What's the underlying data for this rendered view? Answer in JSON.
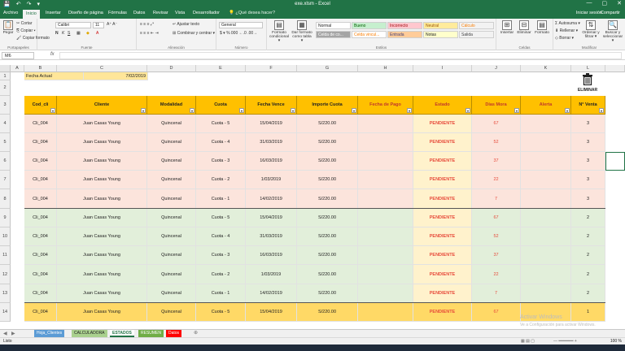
{
  "window": {
    "title": "exe.xlsm - Excel",
    "quick_access": [
      "💾",
      "↶",
      "↷",
      "▾"
    ],
    "min": "—",
    "max": "▢",
    "close": "✕"
  },
  "tabs": [
    "Archivo",
    "Inicio",
    "Insertar",
    "Diseño de página",
    "Fórmulas",
    "Datos",
    "Revisar",
    "Vista",
    "Desarrollador"
  ],
  "tell_me": "¿Qué desea hacer?",
  "signin": "Iniciar sesión",
  "share": "Compartir",
  "ribbon": {
    "paste": "Pegar",
    "cut": "Cortar",
    "copy": "Copiar ▾",
    "format_painter": "Copiar formato",
    "clipboard_label": "Portapapeles",
    "font_name": "Calibri",
    "font_size": "11",
    "font_label": "Fuente",
    "wrap": "Ajustar texto",
    "merge": "Combinar y centrar ▾",
    "align_label": "Alineación",
    "number_format": "General",
    "number_label": "Número",
    "cond_format": "Formato condicional ▾",
    "as_table": "Dar formato como tabla ▾",
    "styles": [
      {
        "text": "Normal",
        "bg": "#ffffff",
        "fg": "#222222"
      },
      {
        "text": "Bueno",
        "bg": "#c6efce",
        "fg": "#006100"
      },
      {
        "text": "Incorrecto",
        "bg": "#ffc7ce",
        "fg": "#9c0006"
      },
      {
        "text": "Neutral",
        "bg": "#ffeb9c",
        "fg": "#9c5700"
      },
      {
        "text": "Cálculo",
        "bg": "#f2f2f2",
        "fg": "#fa7d00"
      },
      {
        "text": "Celda de co...",
        "bg": "#a5a5a5",
        "fg": "#ffffff"
      },
      {
        "text": "Celda vincul...",
        "bg": "#ffffff",
        "fg": "#fa7d00"
      },
      {
        "text": "Entrada",
        "bg": "#ffcc99",
        "fg": "#3f3f76"
      },
      {
        "text": "Notas",
        "bg": "#ffffcc",
        "fg": "#222222"
      },
      {
        "text": "Salida",
        "bg": "#f2f2f2",
        "fg": "#3f3f3f"
      }
    ],
    "styles_label": "Estilos",
    "insert": "Insertar",
    "delete": "Eliminar",
    "format": "Formato",
    "cells_label": "Celdas",
    "autosum": "Autosuma ▾",
    "fill": "Rellenar ▾",
    "clear": "Borrar ▾",
    "sort": "Ordenar y filtrar ▾",
    "find": "Buscar y seleccionar ▾",
    "edit_label": "Modificar"
  },
  "formula_bar": {
    "name_box": "M6",
    "fx": "fx",
    "content": ""
  },
  "columns": [
    "A",
    "B",
    "C",
    "D",
    "E",
    "F",
    "G",
    "H",
    "I",
    "J",
    "K",
    "L"
  ],
  "row_numbers": [
    "1",
    "2",
    "3",
    "4",
    "5",
    "6",
    "7",
    "8",
    "9",
    "10",
    "11",
    "12",
    "13",
    "14"
  ],
  "fecha_actual_label": "Fecha Actual",
  "fecha_actual_value": "7/02/2019",
  "eliminar": "ELIMINAR",
  "headers": [
    "Cod_cli",
    "Cliente",
    "Modalidad",
    "Cuota",
    "Fecha Vence",
    "Importe Cuota",
    "Fecha de Pago",
    "Estado",
    "Días Mora",
    "Alerta",
    "N° Venta"
  ],
  "rows": [
    {
      "cod": "Cli_004",
      "cliente": "Juan Casas Young",
      "modalidad": "Quincenal",
      "cuota": "Cuota - 5",
      "fecha": "15/04/2019",
      "importe": "S/220.00",
      "pago": "",
      "estado": "PENDIENTE",
      "dias": "67",
      "alerta": "",
      "venta": "3"
    },
    {
      "cod": "Cli_004",
      "cliente": "Juan Casas Young",
      "modalidad": "Quincenal",
      "cuota": "Cuota - 4",
      "fecha": "31/03/2019",
      "importe": "S/220.00",
      "pago": "",
      "estado": "PENDIENTE",
      "dias": "52",
      "alerta": "",
      "venta": "3"
    },
    {
      "cod": "Cli_004",
      "cliente": "Juan Casas Young",
      "modalidad": "Quincenal",
      "cuota": "Cuota - 3",
      "fecha": "16/03/2019",
      "importe": "S/220.00",
      "pago": "",
      "estado": "PENDIENTE",
      "dias": "37",
      "alerta": "",
      "venta": "3"
    },
    {
      "cod": "Cli_004",
      "cliente": "Juan Casas Young",
      "modalidad": "Quincenal",
      "cuota": "Cuota - 2",
      "fecha": "1/03/2019",
      "importe": "S/220.00",
      "pago": "",
      "estado": "PENDIENTE",
      "dias": "22",
      "alerta": "",
      "venta": "3"
    },
    {
      "cod": "Cli_004",
      "cliente": "Juan Casas Young",
      "modalidad": "Quincenal",
      "cuota": "Cuota - 1",
      "fecha": "14/02/2019",
      "importe": "S/220.00",
      "pago": "",
      "estado": "PENDIENTE",
      "dias": "7",
      "alerta": "",
      "venta": "3"
    },
    {
      "cod": "Cli_004",
      "cliente": "Juan Casas Young",
      "modalidad": "Quincenal",
      "cuota": "Cuota - 5",
      "fecha": "15/04/2019",
      "importe": "S/220.00",
      "pago": "",
      "estado": "PENDIENTE",
      "dias": "67",
      "alerta": "",
      "venta": "2"
    },
    {
      "cod": "Cli_004",
      "cliente": "Juan Casas Young",
      "modalidad": "Quincenal",
      "cuota": "Cuota - 4",
      "fecha": "31/03/2019",
      "importe": "S/220.00",
      "pago": "",
      "estado": "PENDIENTE",
      "dias": "52",
      "alerta": "",
      "venta": "2"
    },
    {
      "cod": "Cli_004",
      "cliente": "Juan Casas Young",
      "modalidad": "Quincenal",
      "cuota": "Cuota - 3",
      "fecha": "16/03/2019",
      "importe": "S/220.00",
      "pago": "",
      "estado": "PENDIENTE",
      "dias": "37",
      "alerta": "",
      "venta": "2"
    },
    {
      "cod": "Cli_004",
      "cliente": "Juan Casas Young",
      "modalidad": "Quincenal",
      "cuota": "Cuota - 2",
      "fecha": "1/03/2019",
      "importe": "S/220.00",
      "pago": "",
      "estado": "PENDIENTE",
      "dias": "22",
      "alerta": "",
      "venta": "2"
    },
    {
      "cod": "Cli_004",
      "cliente": "Juan Casas Young",
      "modalidad": "Quincenal",
      "cuota": "Cuota - 1",
      "fecha": "14/02/2019",
      "importe": "S/220.00",
      "pago": "",
      "estado": "PENDIENTE",
      "dias": "7",
      "alerta": "",
      "venta": "2"
    },
    {
      "cod": "Cli_004",
      "cliente": "Juan Casas Young",
      "modalidad": "Quincenal",
      "cuota": "Cuota - 5",
      "fecha": "15/04/2019",
      "importe": "S/220.00",
      "pago": "",
      "estado": "PENDIENTE",
      "dias": "67",
      "alerta": "",
      "venta": "1"
    }
  ],
  "row_colors": [
    "#fce4dc",
    "#fce4dc",
    "#fce4dc",
    "#fce4dc",
    "#fce4dc",
    "#e2efda",
    "#e2efda",
    "#e2efda",
    "#e2efda",
    "#e2efda",
    "#ffd966"
  ],
  "estado_bg": "#fff2cc",
  "sheets": [
    {
      "name": "Hoja_Clientes",
      "bg": "#5b9bd5",
      "fg": "#ffffff"
    },
    {
      "name": "CALCULADORA",
      "bg": "#a9d08e",
      "fg": "#222222"
    },
    {
      "name": "ESTADOS",
      "bg": "#ffffff",
      "fg": "#217346"
    },
    {
      "name": "RESUMEN",
      "bg": "#70ad47",
      "fg": "#ffffff"
    },
    {
      "name": "Datos",
      "bg": "#ff0000",
      "fg": "#ffffff"
    }
  ],
  "add_sheet": "⊕",
  "status_left": "Listo",
  "zoom": "100 %",
  "watermark_title": "Activar Windows",
  "watermark_sub": "Ve a Configuración para activar Windows."
}
